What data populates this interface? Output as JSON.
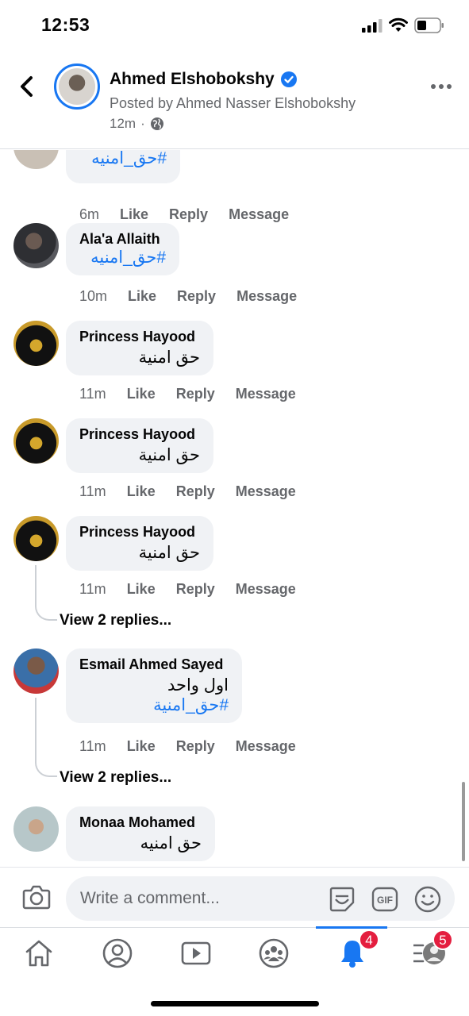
{
  "status_bar": {
    "time": "12:53"
  },
  "header": {
    "author": "Ahmed Elshobokshy",
    "posted_by": "Posted by Ahmed Nasser Elshobokshy",
    "time": "12m",
    "separator": "·"
  },
  "comments": [
    {
      "name": "",
      "text": "",
      "hashtag": "#حق_امنيه",
      "time": "6m",
      "like": "Like",
      "reply": "Reply",
      "message": "Message"
    },
    {
      "name": "Ala'a Allaith",
      "text": "",
      "hashtag": "#حق_امنيه",
      "time": "10m",
      "like": "Like",
      "reply": "Reply",
      "message": "Message"
    },
    {
      "name": "Princess Hayood",
      "text": "حق امنية",
      "time": "11m",
      "like": "Like",
      "reply": "Reply",
      "message": "Message"
    },
    {
      "name": "Princess Hayood",
      "text": "حق امنية",
      "time": "11m",
      "like": "Like",
      "reply": "Reply",
      "message": "Message"
    },
    {
      "name": "Princess Hayood",
      "text": "حق امنية",
      "time": "11m",
      "like": "Like",
      "reply": "Reply",
      "message": "Message",
      "view_replies": "View 2 replies..."
    },
    {
      "name": "Esmail Ahmed Sayed",
      "text": "اول واحد",
      "hashtag": "#حق_امنية",
      "time": "11m",
      "like": "Like",
      "reply": "Reply",
      "message": "Message",
      "view_replies": "View 2 replies..."
    },
    {
      "name": "Monaa Mohamed",
      "text": "حق امنيه"
    }
  ],
  "composer": {
    "placeholder": "Write a comment...",
    "gif_label": "GIF"
  },
  "nav": {
    "notifications_badge": "4",
    "menu_badge": "5"
  },
  "colors": {
    "accent": "#1877f2",
    "badge": "#e41e3f",
    "bubble": "#f0f2f5",
    "secondary_text": "#65676b"
  }
}
